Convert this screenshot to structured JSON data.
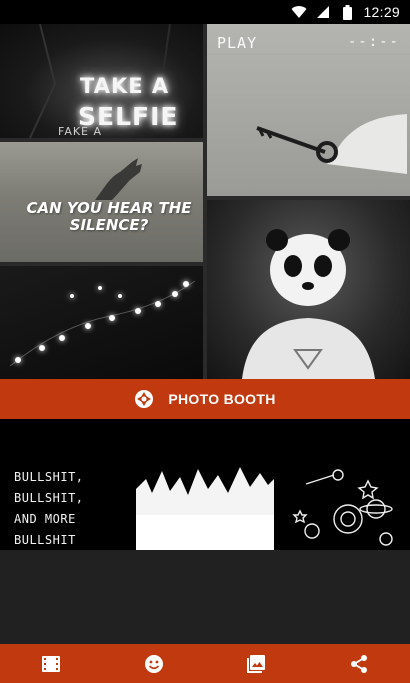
{
  "status_bar": {
    "time": "12:29",
    "icons": [
      "wifi-icon",
      "signal-icon",
      "battery-icon"
    ]
  },
  "collage": {
    "tile_1": {
      "line_1": "TAKE A",
      "line_2": "SELFIE",
      "small": "FAKE A"
    },
    "tile_2": {
      "caption": "CAN YOU HEAR THE SILENCE?"
    },
    "tile_4": {
      "play": "PLAY",
      "timer": "--:--"
    }
  },
  "photo_booth": {
    "label": "PHOTO BOOTH",
    "icon": "shutter-icon"
  },
  "stickers": {
    "sticker_1": {
      "text": "BULLSHIT,\nBULLSHIT,\nAND MORE\nBULLSHIT"
    }
  },
  "toolbar": {
    "items": [
      "film-icon",
      "emoji-icon",
      "gallery-icon",
      "share-icon"
    ]
  },
  "colors": {
    "accent": "#c1390f",
    "panel": "#212121",
    "background": "#000000"
  }
}
